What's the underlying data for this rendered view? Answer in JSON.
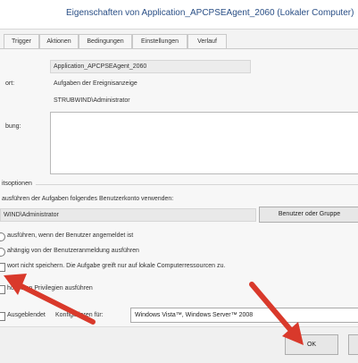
{
  "window": {
    "title": "Eigenschaften von Application_APCPSEAgent_2060 (Lokaler Computer)"
  },
  "tabs": [
    {
      "label": "Trigger"
    },
    {
      "label": "Aktionen"
    },
    {
      "label": "Bedingungen"
    },
    {
      "label": "Einstellungen"
    },
    {
      "label": "Verlauf"
    }
  ],
  "general": {
    "name_value": "Application_APCPSEAgent_2060",
    "location_label": "ort:",
    "location_value": "Aufgaben der Ereignisanzeige",
    "author_value": "STRUBWIND\\Administrator",
    "description_label": "bung:"
  },
  "security": {
    "header": "itsoptionen",
    "account_prompt": "ausführen der Aufgaben folgendes Benutzerkonto verwenden:",
    "account_value": "WIND\\Administrator",
    "change_user_button": "Benutzer oder Gruppe",
    "radio_logged_on": "ausführen, wenn der Benutzer angemeldet ist",
    "radio_regardless": "ahängig von der Benutzeranmeldung ausführen",
    "check_no_password": "wort nicht speichern. Die Aufgabe greift nur auf lokale Computerressourcen zu.",
    "check_highest": "höchsten Privilegien ausführen"
  },
  "config": {
    "hidden_label": "Ausgeblendet",
    "configure_label": "Konfigurieren für:",
    "configure_value": "Windows Vista™, Windows Server™ 2008"
  },
  "footer": {
    "ok_label": "OK"
  },
  "colors": {
    "accent": "#2a4f86",
    "arrow": "#d9392b"
  }
}
